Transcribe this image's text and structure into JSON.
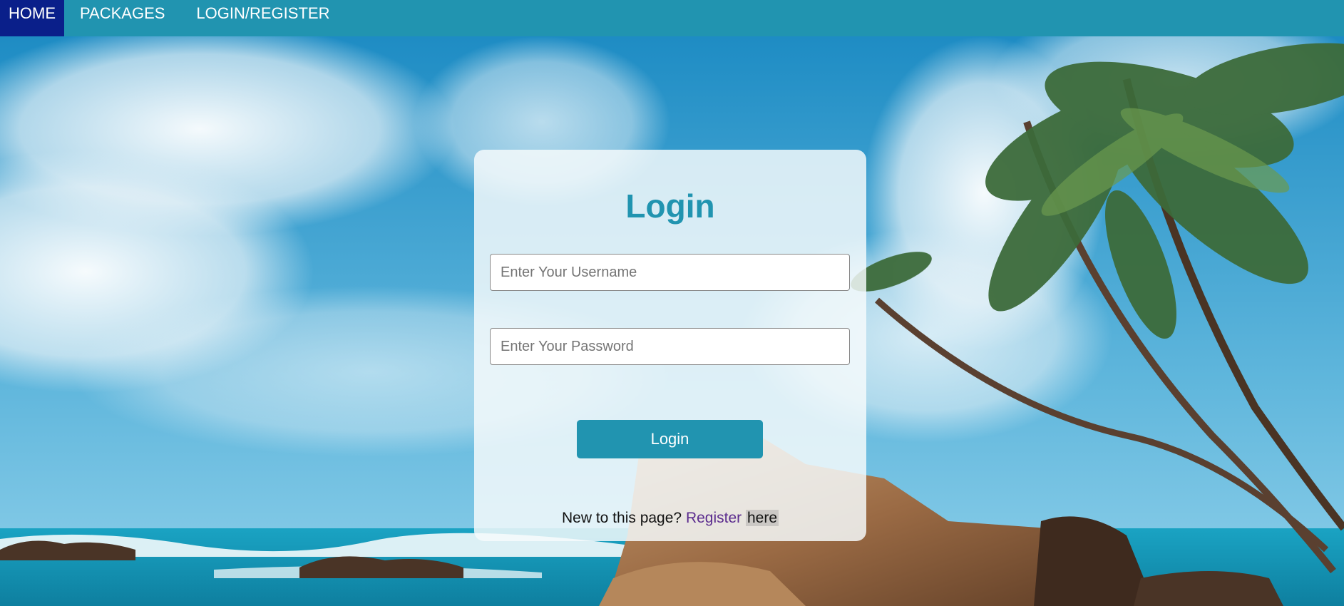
{
  "nav": {
    "items": [
      {
        "label": "HOME",
        "active": true
      },
      {
        "label": "PACKAGES",
        "active": false
      },
      {
        "label": "LOGIN/REGISTER",
        "active": false
      }
    ]
  },
  "login": {
    "title": "Login",
    "username_placeholder": "Enter Your Username",
    "username_value": "",
    "password_placeholder": "Enter Your Password",
    "password_value": "",
    "button_label": "Login",
    "register_prompt": "New to this page?",
    "register_link": "Register",
    "register_suffix": "here"
  },
  "colors": {
    "nav_bg": "#2194b0",
    "nav_active_bg": "#0a1f8a",
    "accent": "#2194b0",
    "link": "#5b2c8e"
  }
}
